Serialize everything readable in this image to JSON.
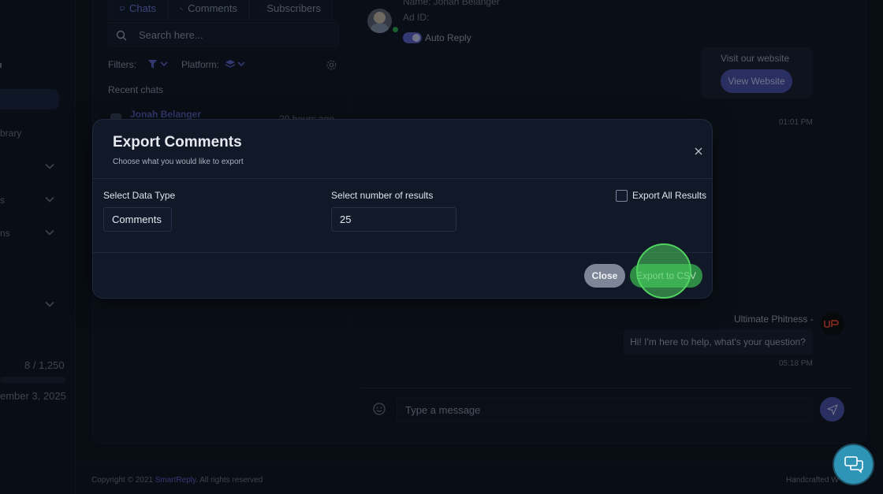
{
  "sidebar": {
    "items": [
      {
        "label": "brary",
        "has_chevron": false
      },
      {
        "label": "",
        "has_chevron": true
      },
      {
        "label": "s",
        "has_chevron": true
      },
      {
        "label": "ns",
        "has_chevron": true
      },
      {
        "label": "",
        "has_chevron": true
      }
    ],
    "usage": "8 / 1,250",
    "renewal": "ember 3, 2025"
  },
  "tabs": [
    {
      "label": "Chats",
      "icon": "chat-icon",
      "active": true
    },
    {
      "label": "Comments",
      "icon": "phone-comment-icon",
      "active": false
    },
    {
      "label": "Subscribers",
      "icon": "users-icon",
      "active": false
    }
  ],
  "search": {
    "placeholder": "Search here..."
  },
  "filters": {
    "filters_label": "Filters:",
    "platform_label": "Platform:"
  },
  "recent_chats": {
    "heading": "Recent chats",
    "items": [
      {
        "name": "Jonah Belanger",
        "time": "20 hours ago"
      }
    ]
  },
  "chat_header": {
    "name_line": "Name: Jonah Belanger",
    "ad_id_line": "Ad ID:",
    "auto_reply_label": "Auto Reply"
  },
  "messages": {
    "visit_text": "Visit our website",
    "view_button": "View Website",
    "time1": "01:01 PM",
    "sender": "Ultimate Phitness -",
    "bot_message": "Hi! I'm here to help, what's your question?",
    "time2": "05:18 PM",
    "input_placeholder": "Type a message"
  },
  "footer": {
    "copyright_prefix": "Copyright © 2021 ",
    "brand": "SmartReply",
    "copyright_suffix": ". All rights reserved",
    "right_text": "Handcrafted W"
  },
  "modal": {
    "title": "Export Comments",
    "subtitle": "Choose what you would like to export",
    "data_type_label": "Select Data Type",
    "data_type_value": "Comments",
    "results_label": "Select number of results",
    "results_value": "25",
    "export_all_label": "Export All Results",
    "export_all_checked": false,
    "close_button": "Close",
    "export_button": "Export to CSV"
  },
  "colors": {
    "accent": "#5a5fc4",
    "export_green": "#2e8c45",
    "chat_fab": "#2f95b7"
  }
}
